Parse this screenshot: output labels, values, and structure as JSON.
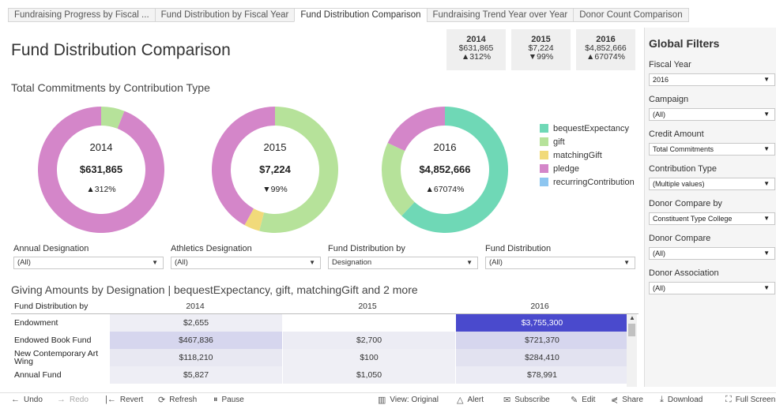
{
  "tabs": [
    "Fundraising Progress by Fiscal ...",
    "Fund Distribution by Fiscal Year",
    "Fund Distribution Comparison",
    "Fundraising Trend Year over Year",
    "Donor Count Comparison"
  ],
  "active_tab": 2,
  "page_title": "Fund Distribution Comparison",
  "kpis": [
    {
      "year": "2014",
      "amount": "$631,865",
      "change": "▲312%"
    },
    {
      "year": "2015",
      "amount": "$7,224",
      "change": "▼99%"
    },
    {
      "year": "2016",
      "amount": "$4,852,666",
      "change": "▲67074%"
    }
  ],
  "donut_section_title": "Total Commitments by Contribution Type",
  "colors": {
    "bequestExpectancy": "#6fd8b6",
    "gift": "#b6e29a",
    "matchingGift": "#f1da7a",
    "pledge": "#d486c9",
    "recurringContribution": "#8ec6f0"
  },
  "chart_data": [
    {
      "type": "pie",
      "year": "2014",
      "center_amount": "$631,865",
      "center_change": "▲312%",
      "slices": [
        {
          "name": "gift",
          "value": 6
        },
        {
          "name": "pledge",
          "value": 94
        }
      ]
    },
    {
      "type": "pie",
      "year": "2015",
      "center_amount": "$7,224",
      "center_change": "▼99%",
      "slices": [
        {
          "name": "gift",
          "value": 54
        },
        {
          "name": "matchingGift",
          "value": 4
        },
        {
          "name": "pledge",
          "value": 42
        }
      ]
    },
    {
      "type": "pie",
      "year": "2016",
      "center_amount": "$4,852,666",
      "center_change": "▲67074%",
      "slices": [
        {
          "name": "bequestExpectancy",
          "value": 62
        },
        {
          "name": "gift",
          "value": 20
        },
        {
          "name": "pledge",
          "value": 18
        }
      ]
    }
  ],
  "legend": [
    "bequestExpectancy",
    "gift",
    "matchingGift",
    "pledge",
    "recurringContribution"
  ],
  "filters": [
    {
      "label": "Annual Designation",
      "value": "(All)"
    },
    {
      "label": "Athletics Designation",
      "value": "(All)"
    },
    {
      "label": "Fund Distribution by",
      "value": "Designation"
    },
    {
      "label": "Fund Distribution",
      "value": "(All)"
    }
  ],
  "table_title": "Giving Amounts by Designation | bequestExpectancy, gift, matchingGift and 2 more",
  "table": {
    "headers": [
      "Fund Distribution by",
      "2014",
      "2015",
      "2016"
    ],
    "rows": [
      {
        "name": "Endowment",
        "cells": [
          "$2,655",
          "",
          "$3,755,300"
        ]
      },
      {
        "name": "Endowed Book Fund",
        "cells": [
          "$467,836",
          "$2,700",
          "$721,370"
        ]
      },
      {
        "name": "New Contemporary Art Wing",
        "cells": [
          "$118,210",
          "$100",
          "$284,410"
        ]
      },
      {
        "name": "Annual Fund",
        "cells": [
          "$5,827",
          "$1,050",
          "$78,991"
        ]
      }
    ]
  },
  "global_filters": {
    "title": "Global Filters",
    "items": [
      {
        "label": "Fiscal Year",
        "value": "2016"
      },
      {
        "label": "Campaign",
        "value": "(All)"
      },
      {
        "label": "Credit Amount",
        "value": "Total Commitments"
      },
      {
        "label": "Contribution Type",
        "value": "(Multiple values)"
      },
      {
        "label": "Donor Compare by",
        "value": "Constituent Type College"
      },
      {
        "label": "Donor Compare",
        "value": "(All)"
      },
      {
        "label": "Donor Association",
        "value": "(All)"
      }
    ]
  },
  "toolbar": {
    "undo": "Undo",
    "redo": "Redo",
    "revert": "Revert",
    "refresh": "Refresh",
    "pause": "Pause",
    "view": "View: Original",
    "alert": "Alert",
    "subscribe": "Subscribe",
    "edit": "Edit",
    "share": "Share",
    "download": "Download",
    "fullscreen": "Full Screen"
  }
}
